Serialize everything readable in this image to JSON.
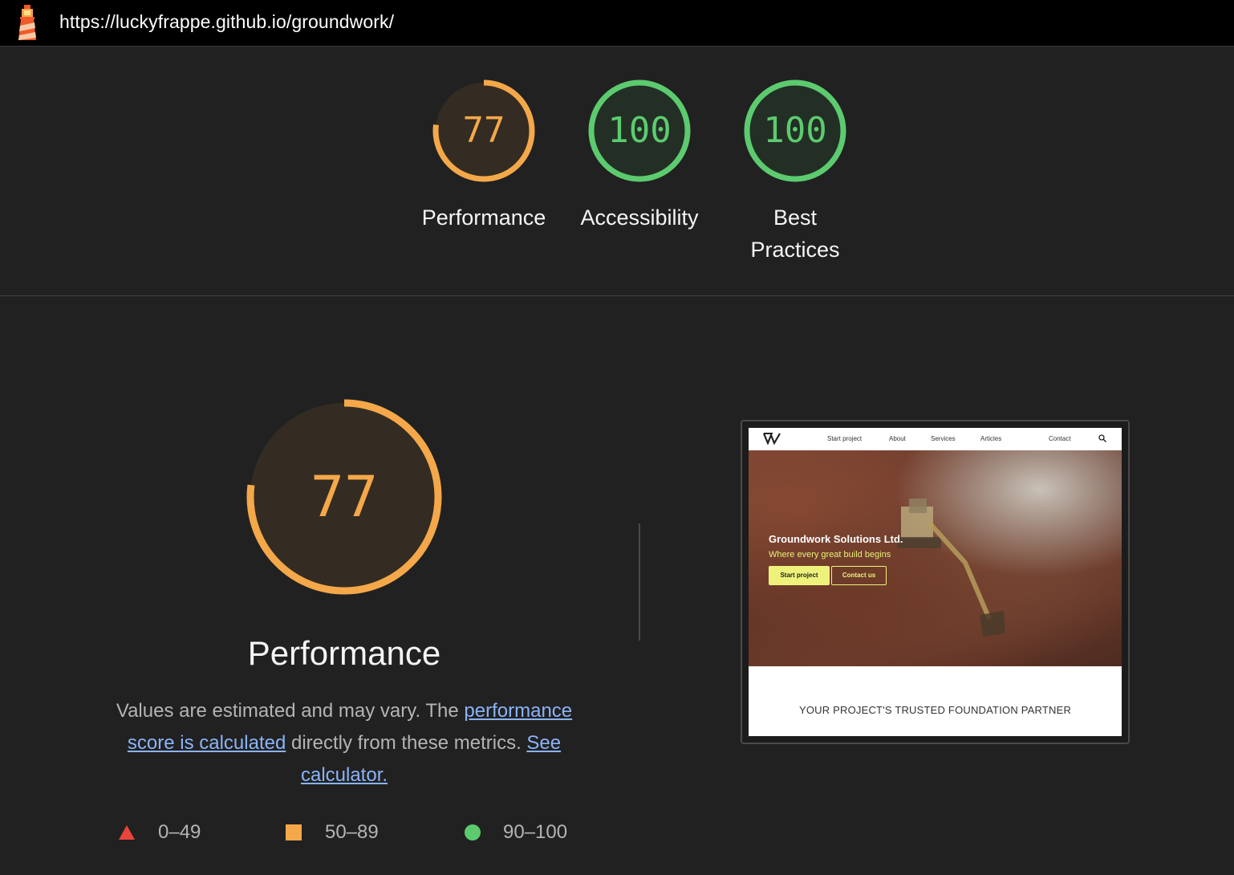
{
  "header": {
    "logo_icon": "lighthouse-icon",
    "url": "https://luckyfrappe.github.io/groundwork/"
  },
  "gauges": [
    {
      "score": "77",
      "label": "Performance",
      "fraction": 0.77,
      "color": "#f4a84a",
      "fill": "#342c22"
    },
    {
      "score": "100",
      "label": "Accessibility",
      "fraction": 1.0,
      "color": "#5ccb6f",
      "fill": "#232f25"
    },
    {
      "score": "100",
      "label": "Best Practices",
      "fraction": 1.0,
      "color": "#5ccb6f",
      "fill": "#232f25"
    }
  ],
  "performance": {
    "score": "77",
    "fraction": 0.77,
    "title": "Performance",
    "desc_text_1": "Values are estimated and may vary. The ",
    "desc_link_1": "performance score is calculated",
    "desc_text_2": " directly from these metrics. ",
    "desc_link_2": "See calculator."
  },
  "legend": [
    {
      "icon": "triangle-red-icon",
      "range": "0–49",
      "color": "#e8453c"
    },
    {
      "icon": "square-orange-icon",
      "range": "50–89",
      "color": "#f4a84a"
    },
    {
      "icon": "circle-green-icon",
      "range": "90–100",
      "color": "#5ccb6f"
    }
  ],
  "screenshot": {
    "nav": [
      "Start project",
      "About",
      "Services",
      "Articles",
      "Contact"
    ],
    "hero_title": "Groundwork Solutions Ltd.",
    "hero_subtitle": "Where every great build begins",
    "btn_primary": "Start project",
    "btn_secondary": "Contact us",
    "tagline": "YOUR PROJECT'S TRUSTED FOUNDATION PARTNER"
  }
}
